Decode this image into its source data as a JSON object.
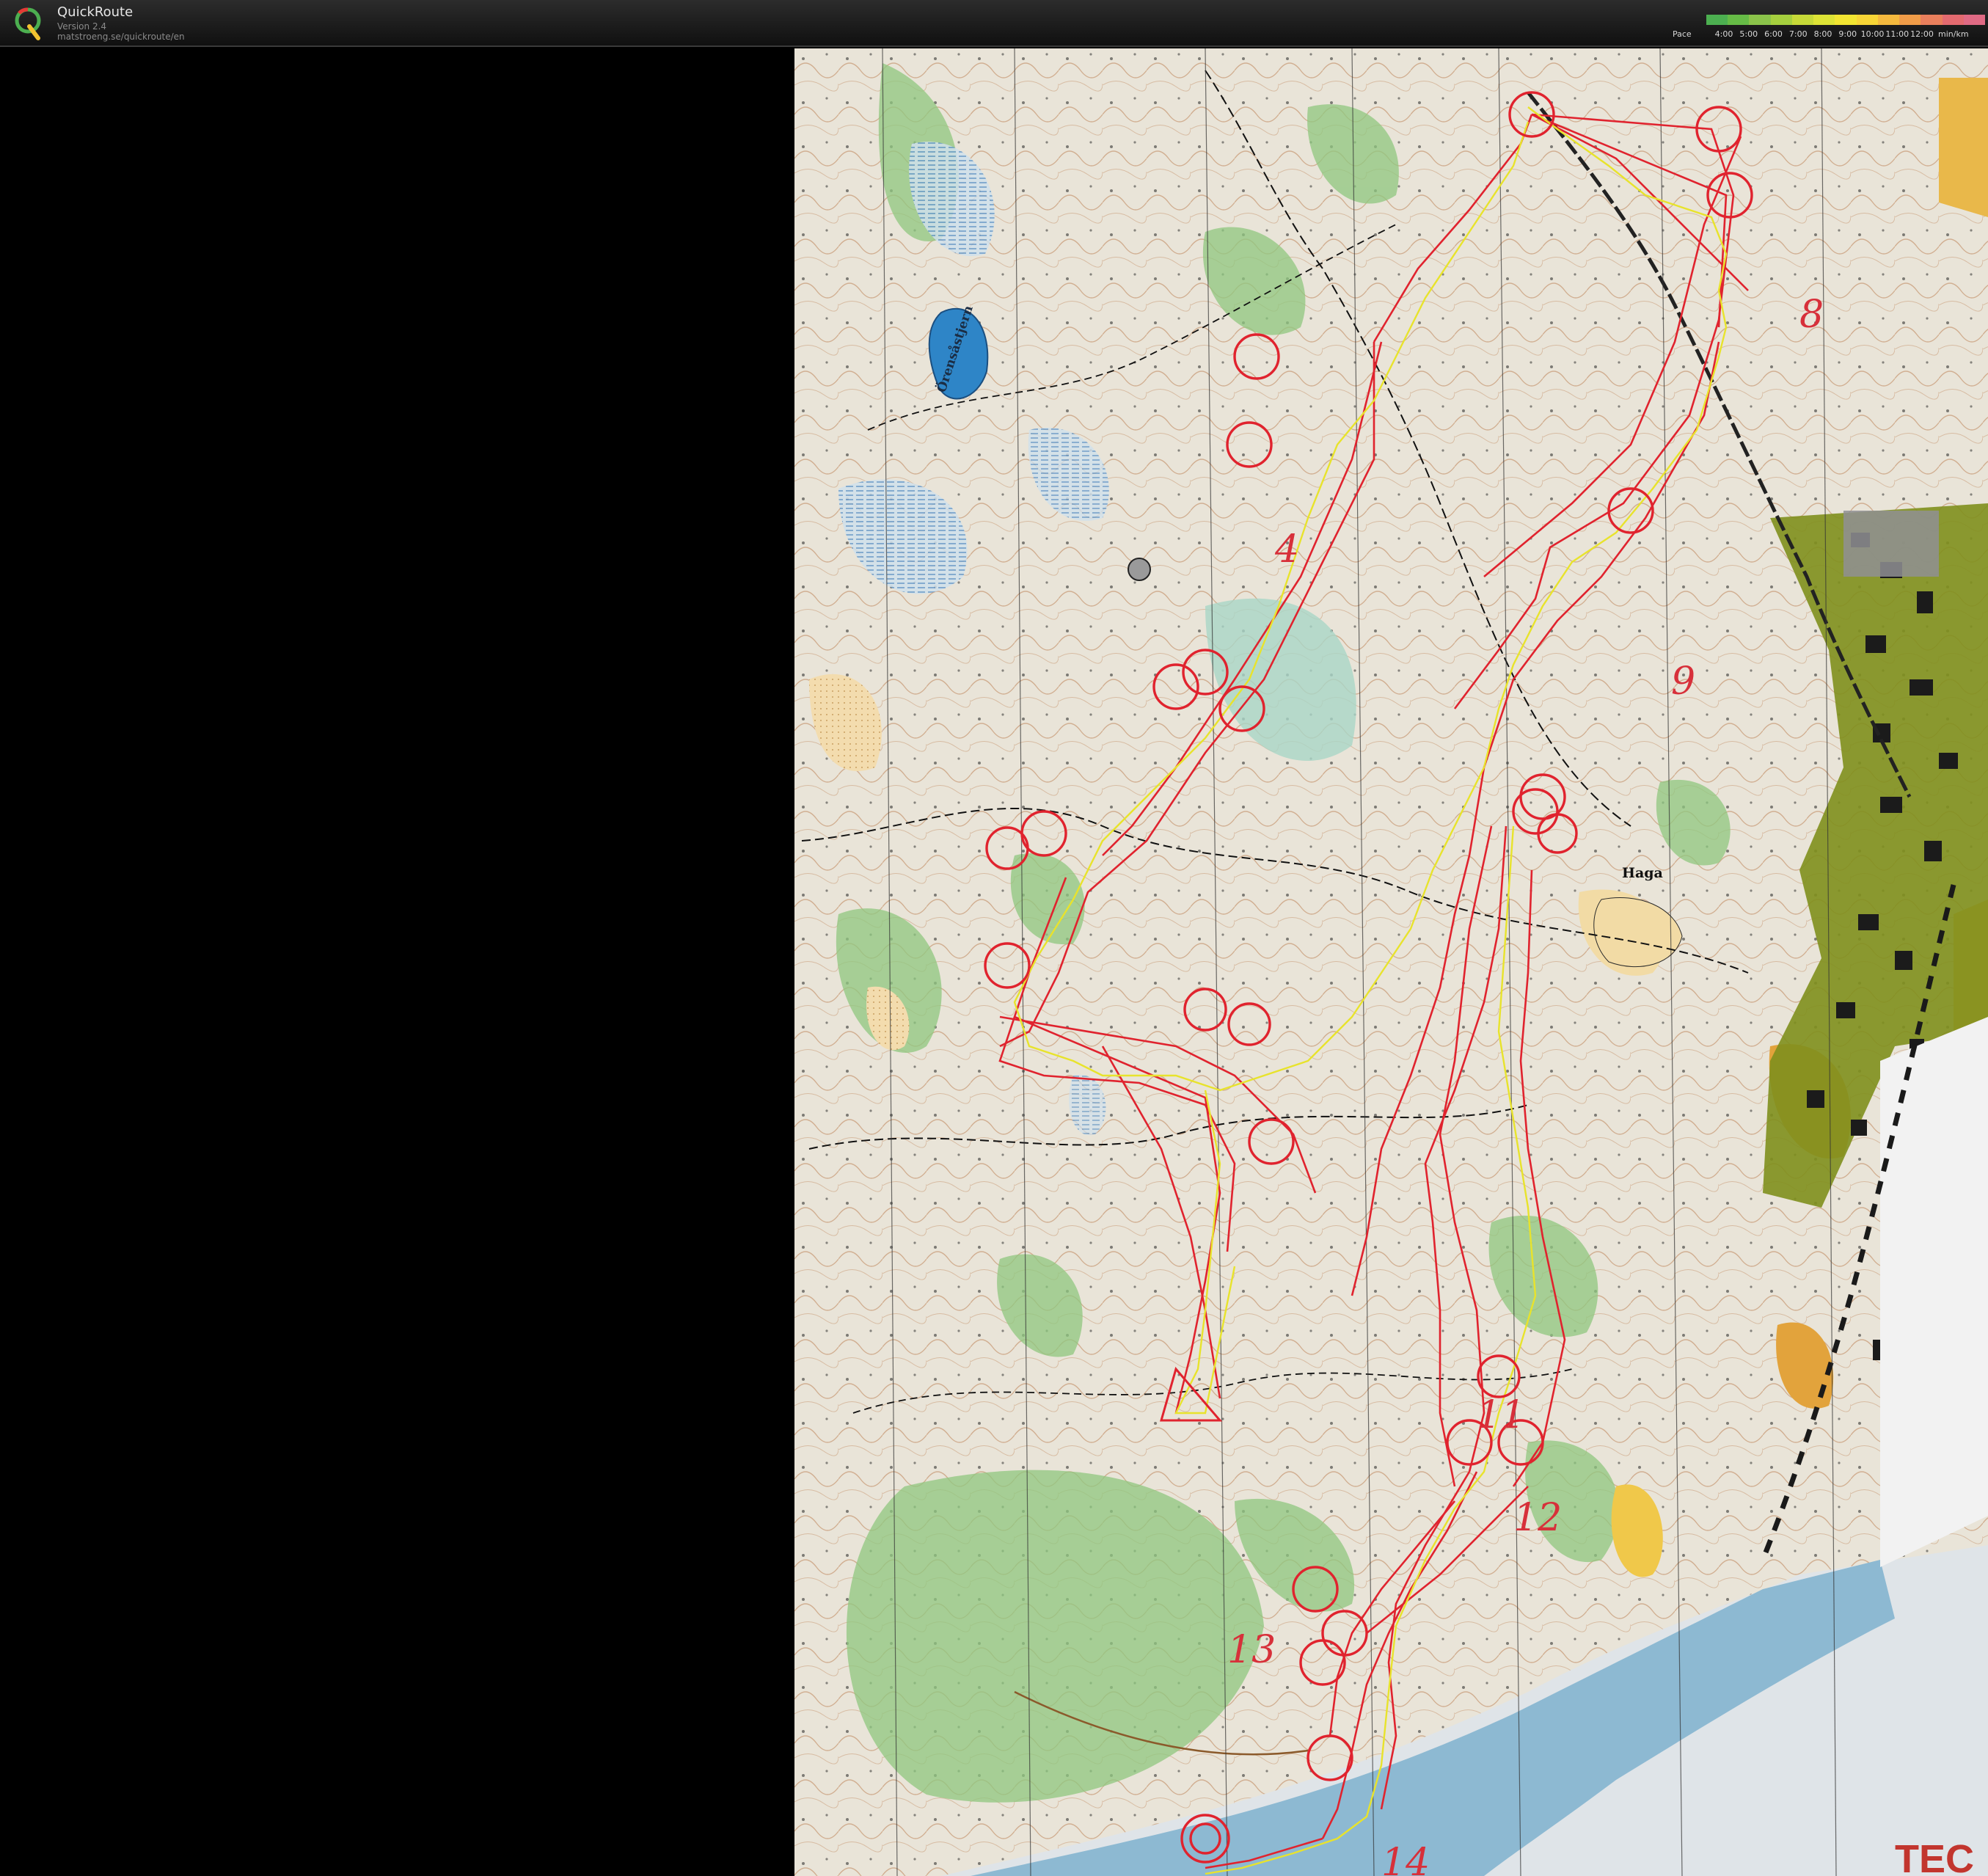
{
  "app": {
    "title": "QuickRoute",
    "version": "Version 2.4",
    "url": "matstroeng.se/quickroute/en"
  },
  "pace_legend": {
    "label": "Pace",
    "ticks": [
      "4:00",
      "5:00",
      "6:00",
      "7:00",
      "8:00",
      "9:00",
      "10:00",
      "11:00",
      "12:00"
    ],
    "unit": "min/km",
    "colors": [
      "#4caf50",
      "#66bb46",
      "#8bc34a",
      "#a5cf3e",
      "#c6d938",
      "#dde336",
      "#f2e532",
      "#f7d536",
      "#f4b93e",
      "#f09c48",
      "#e97f5c",
      "#e36a6f",
      "#e06a84"
    ]
  },
  "map": {
    "place_names": [
      "Haga",
      "Örensåstjern"
    ],
    "partial_text": "TEC",
    "handwritten_numbers": [
      "4",
      "8",
      "9",
      "11",
      "12",
      "13",
      "14"
    ],
    "route_color": "#e0232e",
    "gps_track_color": "#e3e02a",
    "background_color": "#e9e4d8"
  }
}
